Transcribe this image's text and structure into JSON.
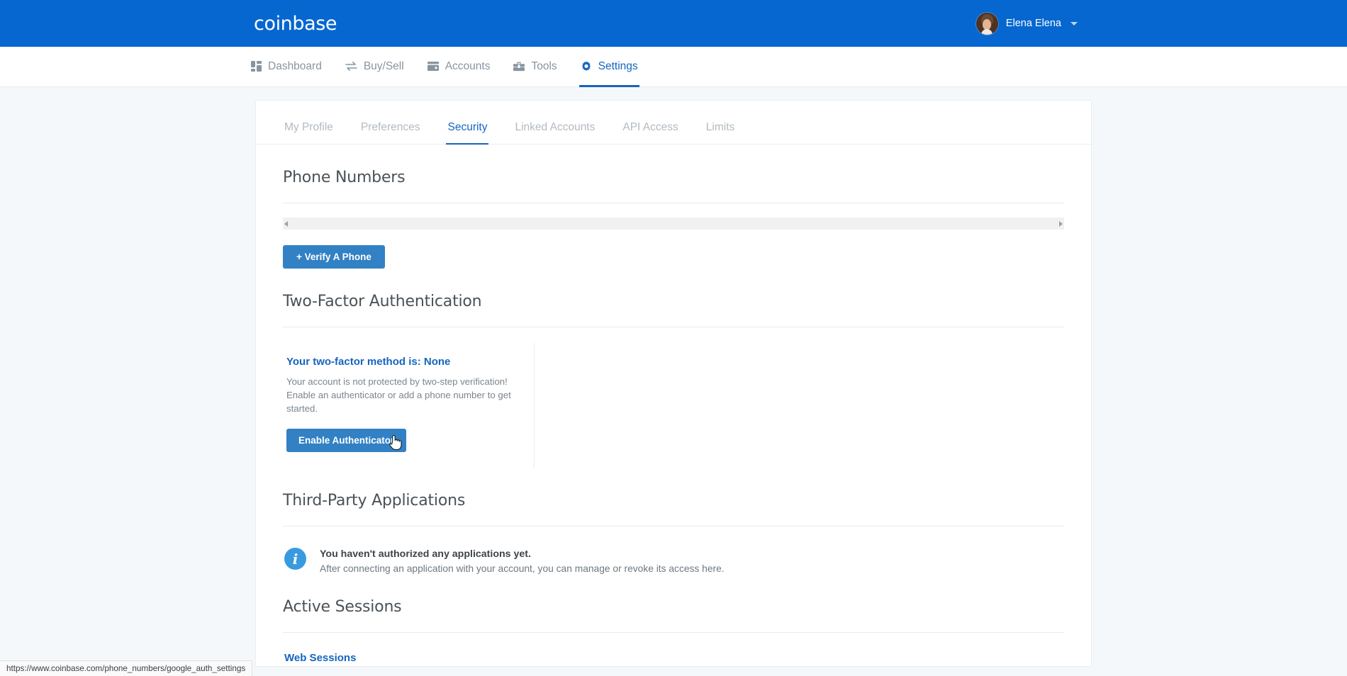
{
  "brand": {
    "name": "coinbase"
  },
  "account": {
    "user_name": "Elena Elena",
    "avatar_alt": "user-avatar",
    "caret": "chevron-down-icon"
  },
  "main_nav": {
    "items": [
      {
        "label": "Dashboard",
        "icon": "grid-icon",
        "active": false
      },
      {
        "label": "Buy/Sell",
        "icon": "exchange-arrows-icon",
        "active": false
      },
      {
        "label": "Accounts",
        "icon": "wallet-icon",
        "active": false
      },
      {
        "label": "Tools",
        "icon": "toolbox-icon",
        "active": false
      },
      {
        "label": "Settings",
        "icon": "gear-icon",
        "active": true
      }
    ]
  },
  "settings_tabs": {
    "items": [
      {
        "label": "My Profile",
        "active": false
      },
      {
        "label": "Preferences",
        "active": false
      },
      {
        "label": "Security",
        "active": true
      },
      {
        "label": "Linked Accounts",
        "active": false
      },
      {
        "label": "API Access",
        "active": false
      },
      {
        "label": "Limits",
        "active": false
      }
    ]
  },
  "phone_numbers": {
    "title": "Phone Numbers",
    "scrollbar": {
      "left_arrow": "triangle-left-icon",
      "right_arrow": "triangle-right-icon"
    },
    "verify_button": "+ Verify A Phone"
  },
  "two_factor": {
    "title": "Two-Factor Authentication",
    "status_heading": "Your two-factor method is: None",
    "description": "Your account is not protected by two-step verification! Enable an authenticator or add a phone number to get started.",
    "enable_button": "Enable Authenticator"
  },
  "third_party": {
    "title": "Third-Party Applications",
    "info_icon": "info-circle-icon",
    "headline": "You haven't authorized any applications yet.",
    "subtext": "After connecting an application with your account, you can manage or revoke its access here."
  },
  "active_sessions": {
    "title": "Active Sessions",
    "web_sessions_label": "Web Sessions"
  },
  "status_bar": {
    "url": "https://www.coinbase.com/phone_numbers/google_auth_settings"
  },
  "colors": {
    "brand_blue": "#0667d0",
    "link_blue": "#1565c0",
    "button_blue": "#3181c4",
    "page_bg": "#f5f8fa",
    "muted_text": "#8795a1",
    "info_blue": "#3a9ae0"
  }
}
